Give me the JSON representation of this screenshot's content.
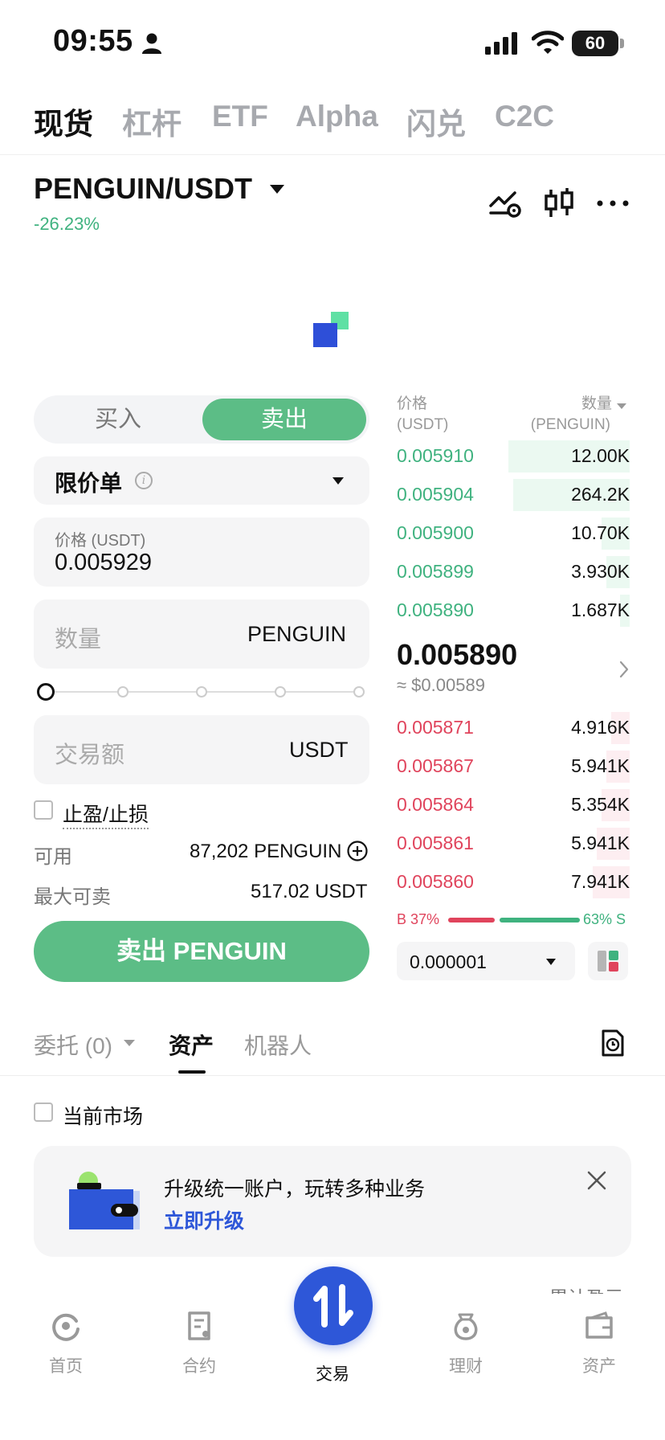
{
  "status_bar": {
    "time": "09:55",
    "battery": "60"
  },
  "top_tabs": [
    {
      "label": "现货"
    },
    {
      "label": "杠杆"
    },
    {
      "label": "ETF"
    },
    {
      "label": "Alpha"
    },
    {
      "label": "闪兑"
    },
    {
      "label": "C2C"
    }
  ],
  "pair": {
    "name": "PENGUIN/USDT",
    "change": "-26.23%"
  },
  "trade_form": {
    "buy_label": "买入",
    "sell_label": "卖出",
    "order_type": "限价单",
    "info_glyph": "i",
    "price_label": "价格 (USDT)",
    "price_value": "0.005929",
    "qty_placeholder": "数量",
    "qty_unit": "PENGUIN",
    "slider_percent": 0,
    "amount_placeholder": "交易额",
    "amount_unit": "USDT",
    "tp_sl_label": "止盈/止损",
    "available_label": "可用",
    "available_value": "87,202 PENGUIN",
    "max_sell_label": "最大可卖",
    "max_sell_value": "517.02 USDT",
    "submit_label": "卖出 PENGUIN"
  },
  "order_book": {
    "price_header": [
      "价格",
      "(USDT)"
    ],
    "qty_header": [
      "数量",
      "(PENGUIN)"
    ],
    "asks": [
      {
        "price": "0.005910",
        "qty": "12.00K",
        "depth": 0.52
      },
      {
        "price": "0.005904",
        "qty": "264.2K",
        "depth": 0.5
      },
      {
        "price": "0.005900",
        "qty": "10.70K",
        "depth": 0.12
      },
      {
        "price": "0.005899",
        "qty": "3.930K",
        "depth": 0.1
      },
      {
        "price": "0.005890",
        "qty": "1.687K",
        "depth": 0.04
      }
    ],
    "last_price": "0.005890",
    "last_price_usd": "≈ $0.00589",
    "bids": [
      {
        "price": "0.005871",
        "qty": "4.916K",
        "depth": 0.08
      },
      {
        "price": "0.005867",
        "qty": "5.941K",
        "depth": 0.1
      },
      {
        "price": "0.005864",
        "qty": "5.354K",
        "depth": 0.12
      },
      {
        "price": "0.005861",
        "qty": "5.941K",
        "depth": 0.14
      },
      {
        "price": "0.005860",
        "qty": "7.941K",
        "depth": 0.16
      }
    ],
    "buy_ratio_label": "B 37%",
    "sell_ratio_label": "63% S",
    "buy_ratio": 0.37,
    "tick_size": "0.000001"
  },
  "lower_tabs": [
    {
      "label": "委托 (0)"
    },
    {
      "label": "资产"
    },
    {
      "label": "机器人"
    }
  ],
  "current_market_label": "当前市场",
  "banner": {
    "title": "升级统一账户，玩转多种业务",
    "link": "立即升级"
  },
  "peek_text": "累计盈亏",
  "bottom_nav": [
    {
      "label": "首页"
    },
    {
      "label": "合约"
    },
    {
      "label": "交易"
    },
    {
      "label": "理财"
    },
    {
      "label": "资产"
    }
  ],
  "colors": {
    "green": "#3fb27f",
    "sell_button": "#5cbd86",
    "red": "#e0445c",
    "brand_blue": "#2e57d8"
  },
  "icons": [
    "person-icon",
    "signal-icon",
    "wifi-icon",
    "chart-alert-icon",
    "candlestick-icon",
    "more-icon",
    "chevron-right-icon",
    "plus-circle-icon",
    "history-icon",
    "close-icon",
    "home-icon",
    "futures-icon",
    "trade-icon",
    "earn-icon",
    "wallet-icon"
  ]
}
